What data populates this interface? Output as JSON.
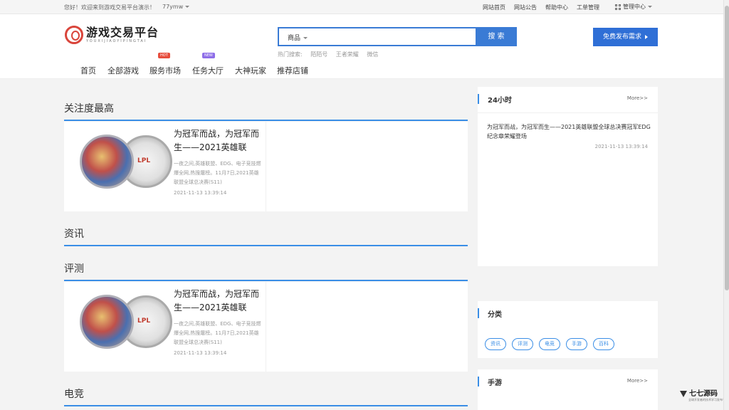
{
  "topbar": {
    "greeting": "您好！欢迎来到游戏交易平台演示！",
    "username": "77ymw",
    "links": [
      "网站首页",
      "网站公告",
      "帮助中心",
      "工单管理"
    ],
    "admin": "管理中心"
  },
  "logo": {
    "cn": "游戏交易平台",
    "en": "YOUXIJIAOYIPINGTAI"
  },
  "search": {
    "category": "商品",
    "placeholder": "",
    "button": "搜 索",
    "hot_label": "热门搜索:",
    "hot_terms": [
      "陌陌号",
      "王者荣耀",
      "微信"
    ]
  },
  "publish_button": "免费发布需求",
  "nav": {
    "items": [
      "首页",
      "全部游戏",
      "服务市场",
      "任务大厅",
      "大神玩家",
      "推荐店铺"
    ],
    "badge_hot": "HOT",
    "badge_new": "NEW"
  },
  "sections": {
    "most_watched": "关注度最高",
    "news": "资讯",
    "review": "评测",
    "esports": "电竞"
  },
  "article": {
    "title": "为冠军而战，为冠军而生——2021英雄联",
    "desc": "一夜之间,英雄联盟、EDG、电子竞技燃爆全网,热搜屠榜。11月7日,2021英雄联盟全球总决赛(S11)",
    "date": "2021-11-13 13:39:14"
  },
  "panel_24h": {
    "title": "24小时",
    "more": "More>>",
    "news_title": "为冠军而战，为冠军而生——2021英雄联盟全球总决赛冠军EDG纪念章荣耀登场",
    "news_date": "2021-11-13 13:39:14"
  },
  "panel_category": {
    "title": "分类",
    "tags": [
      "资讯",
      "评测",
      "电竞",
      "手游",
      "百科"
    ]
  },
  "panel_mobile": {
    "title": "手游",
    "more": "More>>"
  },
  "watermark": {
    "name": "七七源码",
    "sub": "全球开发者的技术学习发布平台"
  }
}
